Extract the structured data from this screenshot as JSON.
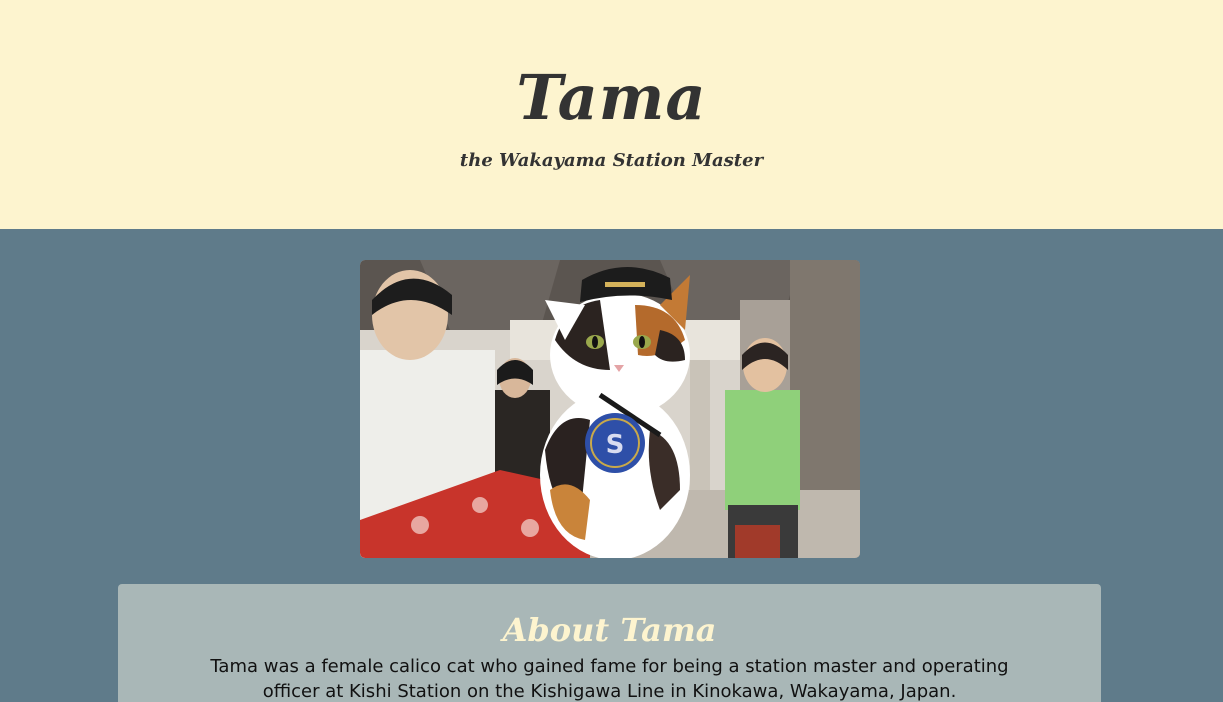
{
  "header": {
    "title": "Tama",
    "subtitle": "the Wakayama Station Master"
  },
  "photo": {
    "alt": "Tama the calico cat wearing a station master hat and badge"
  },
  "about": {
    "heading": "About Tama",
    "text": "Tama was a female calico cat who gained fame for being a station master and operating officer at Kishi Station on the Kishigawa Line in Kinokawa, Wakayama, Japan."
  },
  "colors": {
    "header_bg": "#fdf4cf",
    "page_bg": "#5f7b8a",
    "about_bg": "#a9b7b7",
    "heading_text": "#333333",
    "about_heading": "#fdf4cf"
  }
}
